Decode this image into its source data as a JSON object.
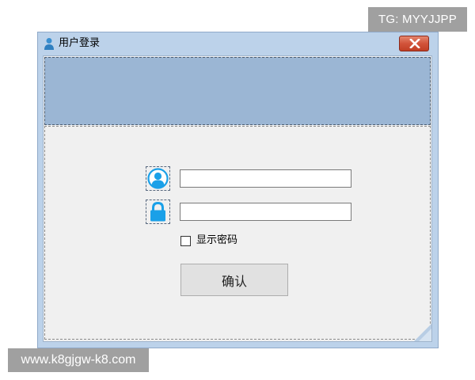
{
  "watermarks": {
    "top_right": "TG: MYYJJPP",
    "bottom_left": "www.k8gjgw-k8.com"
  },
  "window": {
    "title": "用户登录",
    "app_icon": "person-app-icon",
    "close_icon": "close-icon"
  },
  "form": {
    "username_icon": "user-icon",
    "username_value": "",
    "password_icon": "lock-icon",
    "password_value": "",
    "show_password_label": "显示密码",
    "show_password_checked": false,
    "confirm_label": "确认"
  },
  "colors": {
    "banner": "#9bb6d4",
    "icon_blue": "#1aa0e8",
    "close_button": "#d2533a"
  }
}
